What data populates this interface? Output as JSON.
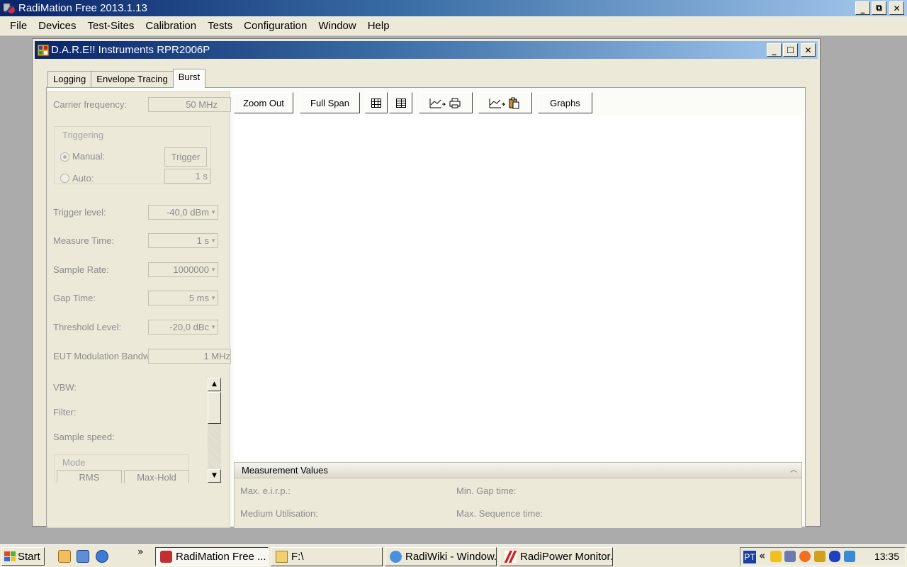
{
  "app": {
    "title": "RadiMation Free 2013.1.13",
    "window_buttons": {
      "minimize": "_",
      "restore": "⧉",
      "close": "✕"
    }
  },
  "menu": [
    "File",
    "Devices",
    "Test-Sites",
    "Calibration",
    "Tests",
    "Configuration",
    "Window",
    "Help"
  ],
  "child_window": {
    "title": "D.A.R.E!! Instruments RPR2006P",
    "window_buttons": {
      "minimize": "_",
      "maximize": "☐",
      "close": "✕"
    }
  },
  "tabs": [
    {
      "label": "Logging",
      "active": false
    },
    {
      "label": "Envelope Tracing",
      "active": false
    },
    {
      "label": "Burst",
      "active": true
    }
  ],
  "settings": {
    "carrier_frequency": {
      "label": "Carrier frequency:",
      "value": "50 MHz"
    },
    "triggering": {
      "title": "Triggering",
      "manual_label": "Manual:",
      "trigger_button": "Trigger",
      "auto_label": "Auto:",
      "auto_value": "1 s",
      "mode_selected": "manual"
    },
    "trigger_level": {
      "label": "Trigger level:",
      "value": "-40,0 dBm"
    },
    "measure_time": {
      "label": "Measure Time:",
      "value": "1 s"
    },
    "sample_rate": {
      "label": "Sample Rate:",
      "value": "1000000"
    },
    "gap_time": {
      "label": "Gap Time:",
      "value": "5 ms"
    },
    "threshold_level": {
      "label": "Threshold Level:",
      "value": "-20,0 dBc"
    },
    "eut_bandwidth": {
      "label": "EUT Modulation Bandwi",
      "value": "1 MHz"
    },
    "vbw_label": "VBW:",
    "filter_label": "Filter:",
    "sample_speed_label": "Sample speed:",
    "mode": {
      "title": "Mode",
      "rms": "RMS",
      "max_hold": "Max-Hold"
    }
  },
  "toolbar": {
    "zoom_out": "Zoom Out",
    "full_span": "Full Span",
    "graphs": "Graphs"
  },
  "measurement_values": {
    "title": "Measurement Values",
    "max_eirp": "Max. e.i.r.p.:",
    "min_gap_time": "Min. Gap time:",
    "medium_utilisation": "Medium Utilisation:",
    "max_sequence_time": "Max. Sequence time:"
  },
  "taskbar": {
    "start": "Start",
    "chevron": "»",
    "tasks": [
      {
        "label": "RadiMation Free ...",
        "active": true
      },
      {
        "label": "F:\\",
        "active": false
      },
      {
        "label": "RadiWiki - Window...",
        "active": false
      },
      {
        "label": "RadiPower Monitor...",
        "active": false
      }
    ],
    "tray": {
      "lang": "PT",
      "chevron": "«",
      "clock": "13:35"
    }
  },
  "colors": {
    "titlebar_start": "#0a246a",
    "titlebar_end": "#a6caf0",
    "window_face": "#ece9d8",
    "disabled_text": "#8c8c8c"
  }
}
